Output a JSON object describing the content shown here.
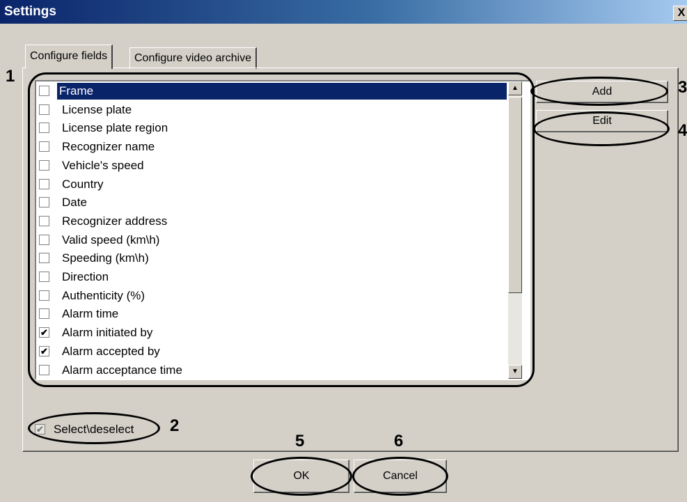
{
  "window": {
    "title": "Settings",
    "close_label": "X"
  },
  "tabs": [
    {
      "label": "Configure fields",
      "active": true
    },
    {
      "label": "Configure video archive",
      "active": false
    }
  ],
  "fields": [
    {
      "label": "Frame",
      "checked": false,
      "selected": true
    },
    {
      "label": "License plate",
      "checked": false
    },
    {
      "label": "License plate region",
      "checked": false
    },
    {
      "label": "Recognizer name",
      "checked": false
    },
    {
      "label": "Vehicle's speed",
      "checked": false
    },
    {
      "label": "Country",
      "checked": false
    },
    {
      "label": "Date",
      "checked": false
    },
    {
      "label": "Recognizer address",
      "checked": false
    },
    {
      "label": "Valid speed (km\\h)",
      "checked": false
    },
    {
      "label": "Speeding (km\\h)",
      "checked": false
    },
    {
      "label": "Direction",
      "checked": false
    },
    {
      "label": "Authenticity (%)",
      "checked": false
    },
    {
      "label": "Alarm time",
      "checked": false
    },
    {
      "label": "Alarm initiated by",
      "checked": true
    },
    {
      "label": "Alarm accepted by",
      "checked": true
    },
    {
      "label": "Alarm acceptance time",
      "checked": false
    }
  ],
  "buttons": {
    "add": "Add",
    "edit": "Edit",
    "ok": "OK",
    "cancel": "Cancel"
  },
  "select_all": {
    "label": "Select\\deselect",
    "checked": true
  },
  "callouts": [
    "1",
    "2",
    "3",
    "4",
    "5",
    "6"
  ]
}
